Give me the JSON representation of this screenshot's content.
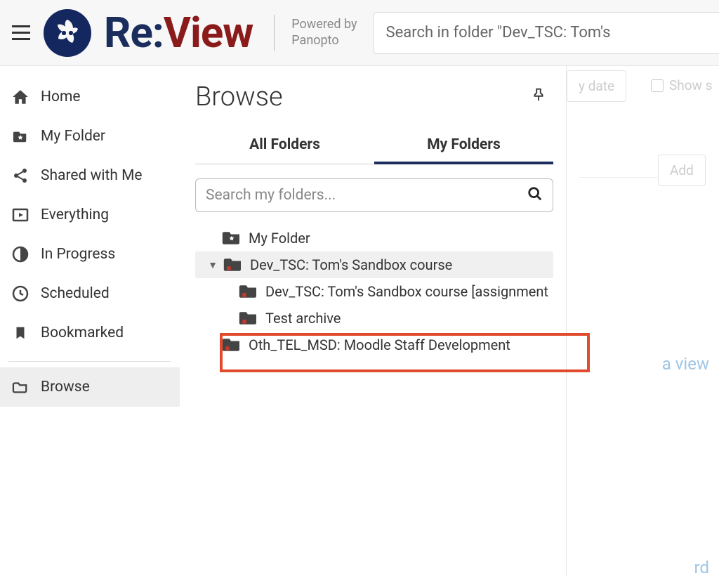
{
  "header": {
    "powered_by": "Powered by\nPanopto",
    "logo_re": "Re:",
    "logo_view": "View",
    "search_placeholder": "Search in folder \"Dev_TSC: Tom's"
  },
  "sidebar": {
    "items": [
      {
        "label": "Home"
      },
      {
        "label": "My Folder"
      },
      {
        "label": "Shared with Me"
      },
      {
        "label": "Everything"
      },
      {
        "label": "In Progress"
      },
      {
        "label": "Scheduled"
      },
      {
        "label": "Bookmarked"
      },
      {
        "label": "Browse"
      }
    ]
  },
  "browse": {
    "title": "Browse",
    "tabs": {
      "all": "All Folders",
      "my": "My Folders"
    },
    "search_placeholder": "Search my folders...",
    "tree": [
      {
        "label": "My Folder"
      },
      {
        "label": "Dev_TSC: Tom's Sandbox course"
      },
      {
        "label": "Dev_TSC: Tom's Sandbox course [assignment"
      },
      {
        "label": "Test archive"
      },
      {
        "label": "Oth_TEL_MSD: Moodle Staff Development"
      }
    ]
  },
  "background": {
    "by_date": "y date",
    "show_s": "Show s",
    "add": "Add",
    "view_link": "a view",
    "rd": "rd"
  }
}
